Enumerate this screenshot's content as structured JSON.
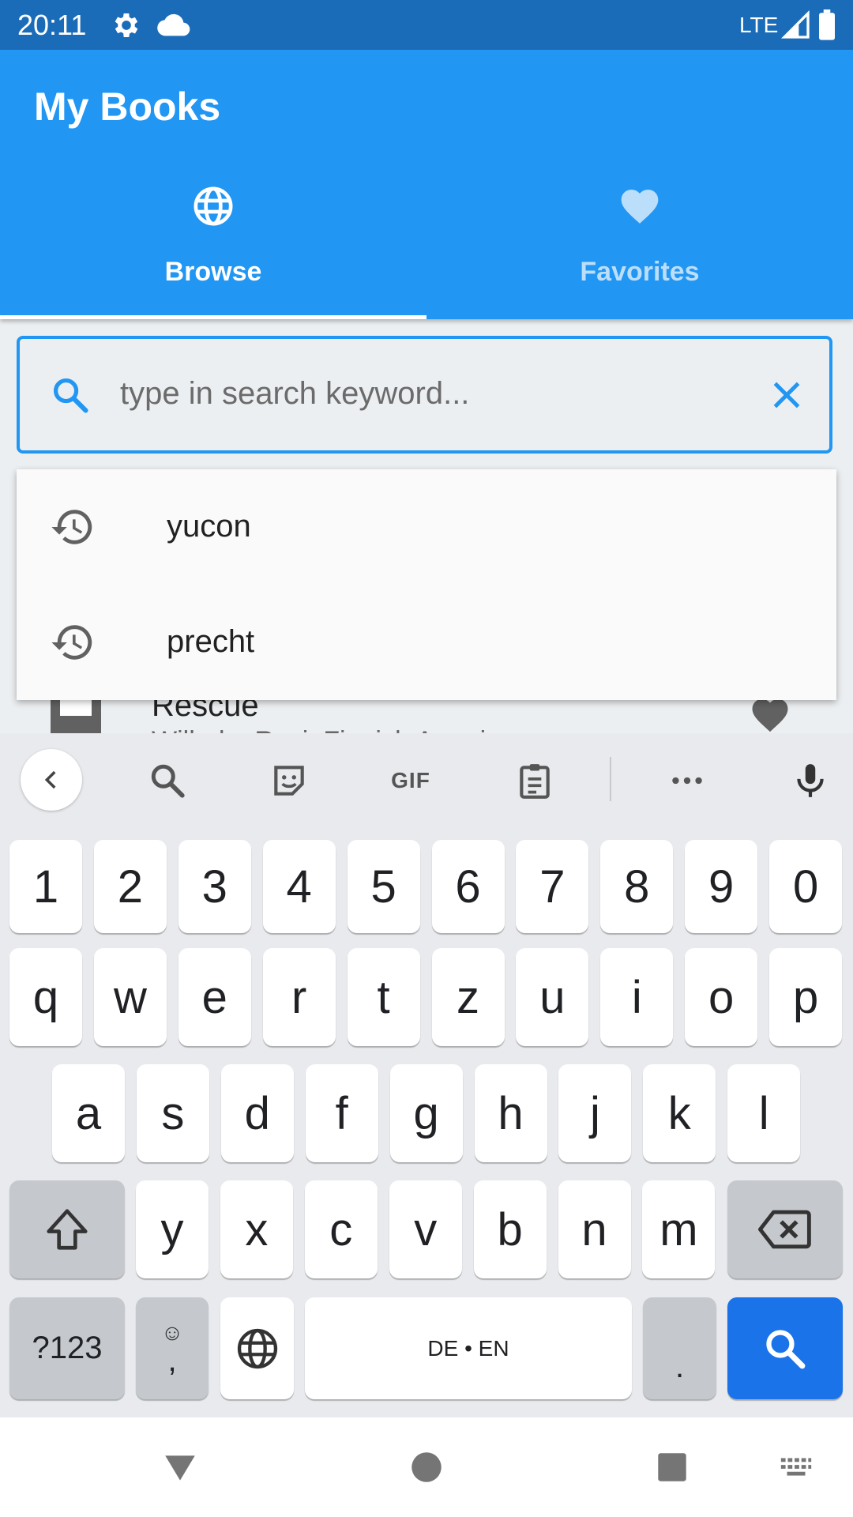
{
  "status_bar": {
    "time": "20:11",
    "network": "LTE",
    "icons": [
      "gear-icon",
      "cloud-icon",
      "signal-icon",
      "battery-icon"
    ]
  },
  "app": {
    "title": "My Books",
    "accent": "#2196f3"
  },
  "tabs": [
    {
      "label": "Browse",
      "icon": "globe-icon",
      "selected": true
    },
    {
      "label": "Favorites",
      "icon": "heart-icon",
      "selected": false
    }
  ],
  "search": {
    "placeholder": "type in search keyword...",
    "value": ""
  },
  "suggestions": [
    {
      "text": "yucon",
      "icon": "history-icon"
    },
    {
      "text": "precht",
      "icon": "history-icon"
    }
  ],
  "background_item": {
    "title": "Rescue",
    "subtitle": "Wilhelm Reci, Finnish American"
  },
  "keyboard": {
    "toolbar": {
      "gif": "GIF"
    },
    "row_numbers": [
      "1",
      "2",
      "3",
      "4",
      "5",
      "6",
      "7",
      "8",
      "9",
      "0"
    ],
    "row1": [
      "q",
      "w",
      "e",
      "r",
      "t",
      "z",
      "u",
      "i",
      "o",
      "p"
    ],
    "row2": [
      "a",
      "s",
      "d",
      "f",
      "g",
      "h",
      "j",
      "k",
      "l"
    ],
    "row3": [
      "y",
      "x",
      "c",
      "v",
      "b",
      "n",
      "m"
    ],
    "symbols_key": "?123",
    "emoji_key_top": "☺",
    "comma_key": ",",
    "space_label": "DE • EN",
    "period_key": ".",
    "enter_color": "#1a73e8"
  }
}
